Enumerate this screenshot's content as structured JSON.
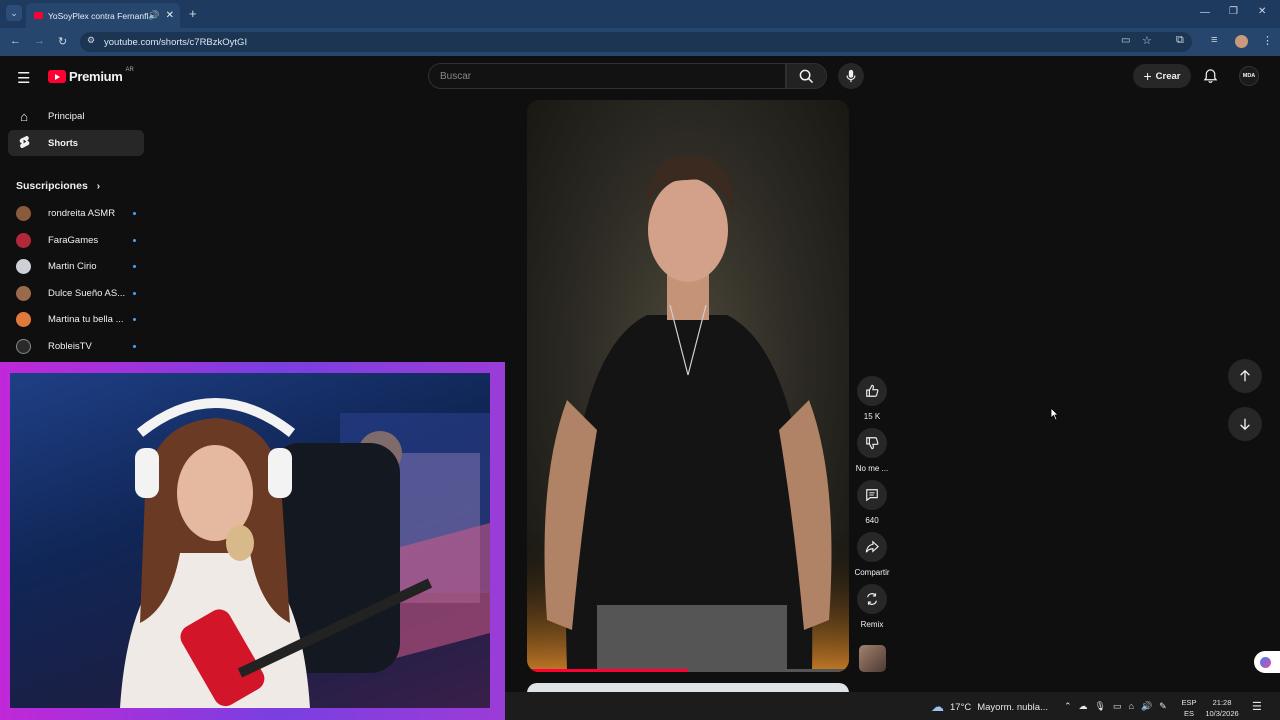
{
  "browser": {
    "tab_title": "YoSoyPlex contra Fernanflo",
    "new_tab": "+",
    "url": "youtube.com/shorts/c7RBzkOytGI",
    "window_controls": [
      "minimize-icon",
      "restore-icon",
      "close-icon"
    ]
  },
  "header": {
    "logo_text": "Premium",
    "logo_region": "AR",
    "search_placeholder": "Buscar",
    "create_label": "Crear",
    "avatar_text": "MDA"
  },
  "sidebar": {
    "nav": [
      {
        "label": "Principal",
        "icon": "home-icon"
      },
      {
        "label": "Shorts",
        "icon": "shorts-icon",
        "active": true
      }
    ],
    "subscriptions_title": "Suscripciones",
    "subscriptions": [
      {
        "name": "rondreita ASMR",
        "color": "#8a5a3c"
      },
      {
        "name": "FaraGames",
        "color": "#b2273a"
      },
      {
        "name": "Martin Cirio",
        "color": "#cfcfd6"
      },
      {
        "name": "Dulce Sueño AS...",
        "color": "#9b6a4a"
      },
      {
        "name": "Martina tu bella ...",
        "color": "#e07a3a"
      },
      {
        "name": "RobleisTV",
        "color": "#2a2a2a"
      }
    ]
  },
  "actions": {
    "like_count": "15 K",
    "dislike_label": "No me ...",
    "comments_count": "640",
    "share_label": "Compartir",
    "remix_label": "Remix"
  },
  "taskbar": {
    "weather_temp": "17°C",
    "weather_text": "Mayorm. nubla...",
    "lang_top": "ESP",
    "lang_bottom": "ES",
    "time": "21:28",
    "date": "10/3/2026"
  },
  "colors": {
    "accent_red": "#ff0033",
    "progress_red": "#ff0033",
    "cam_border": "#c028d8"
  },
  "video": {
    "progress": 0.5
  }
}
